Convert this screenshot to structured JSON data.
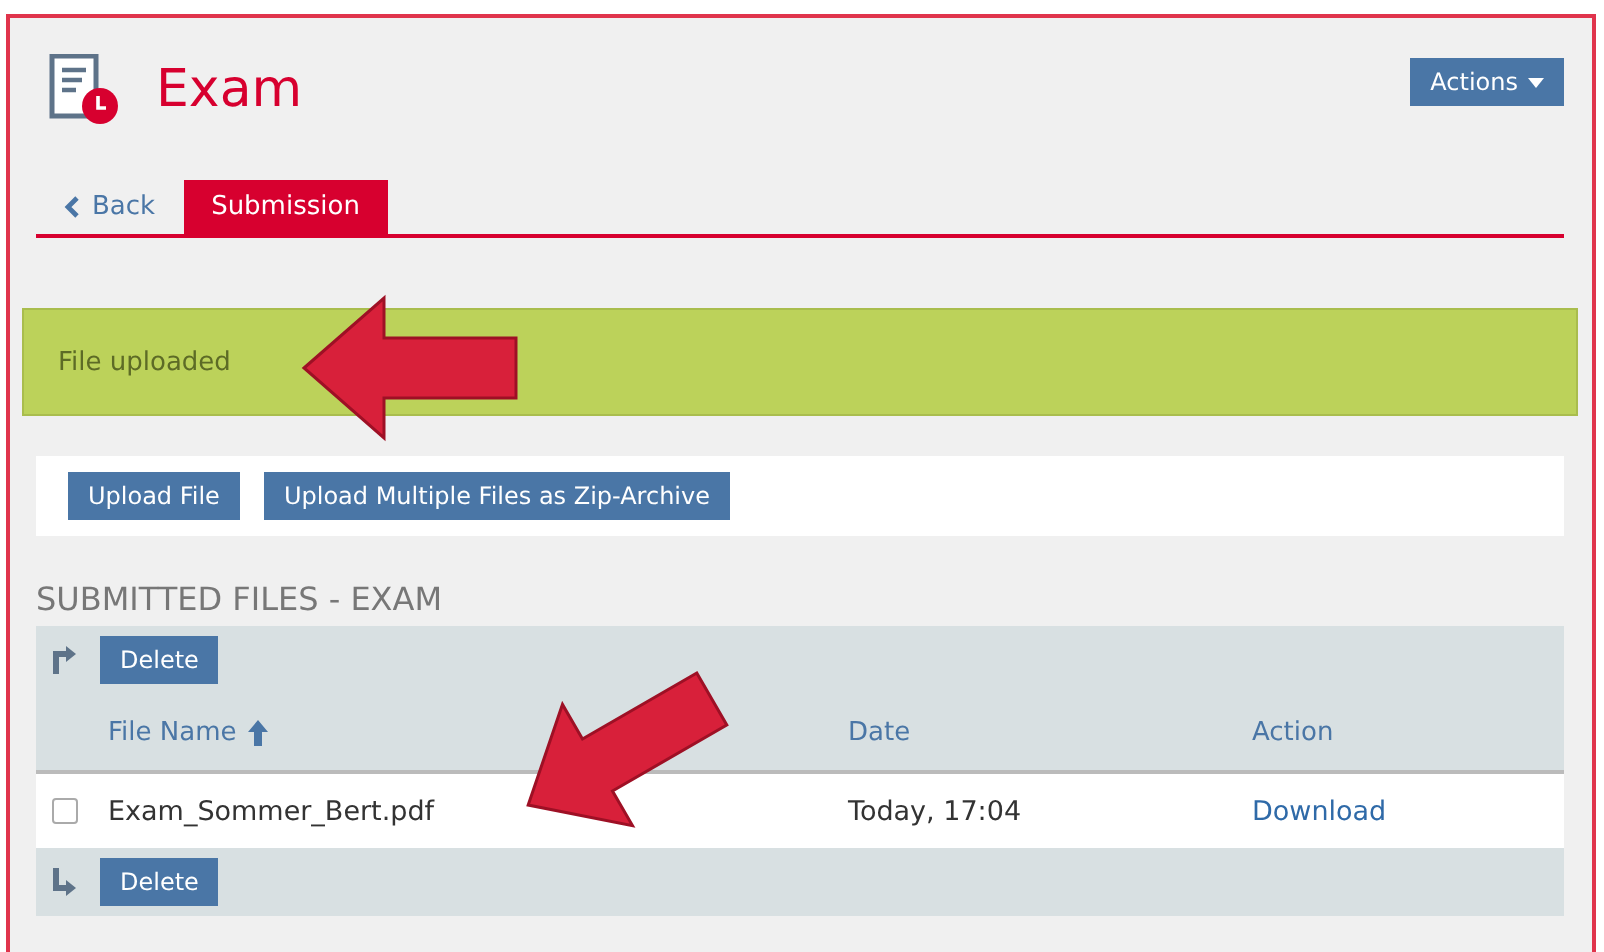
{
  "header": {
    "title": "Exam",
    "actions_button": "Actions"
  },
  "tabs": [
    {
      "label": "Back",
      "kind": "back",
      "selected": false
    },
    {
      "label": "Submission",
      "kind": "tab",
      "selected": true
    }
  ],
  "alert": {
    "message": "File uploaded"
  },
  "toolbar": {
    "buttons": [
      "Upload File",
      "Upload Multiple Files as Zip-Archive"
    ]
  },
  "section_title": "SUBMITTED FILES - EXAM",
  "table": {
    "top_action": "Delete",
    "bottom_action": "Delete",
    "columns": [
      {
        "label": "File Name",
        "sorted": true
      },
      {
        "label": "Date",
        "sorted": false
      },
      {
        "label": "Action",
        "sorted": false
      }
    ],
    "rows": [
      {
        "checked": false,
        "file_name": "Exam_Sommer_Bert.pdf",
        "date": "Today, 17:04",
        "action": "Download"
      }
    ]
  }
}
